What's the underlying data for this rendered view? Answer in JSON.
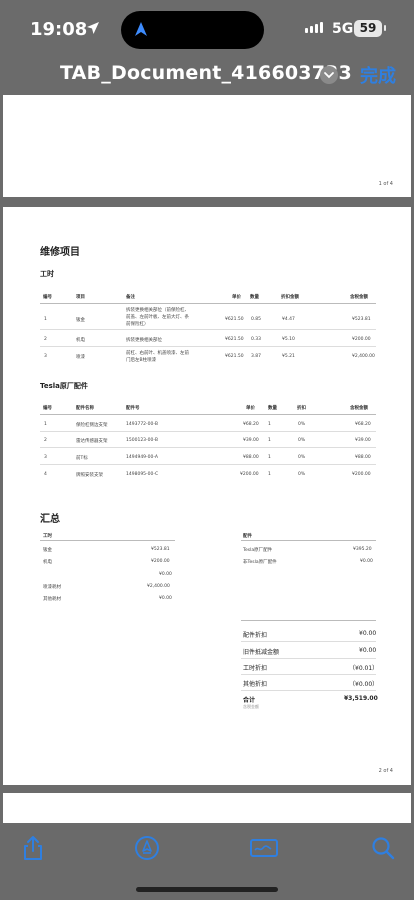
{
  "status": {
    "time": "19:08",
    "network": "5G",
    "battery": "59"
  },
  "titlebar": {
    "title": "TAB_Document_416603733",
    "done": "完成"
  },
  "page1": {
    "page_number": "1 of 4"
  },
  "page2": {
    "page_number": "2 of 4",
    "section_title": "维修项目",
    "labor": {
      "title": "工时",
      "headers": [
        "编号",
        "项目",
        "备注",
        "单价",
        "数量",
        "折扣金额",
        "含税金额"
      ],
      "rows": [
        [
          "1",
          "钣金",
          "",
          "¥621.50",
          "0.85",
          "¥4.47",
          "¥523.81"
        ],
        [
          "2",
          "机电",
          "拆装更换相关部位",
          "¥621.50",
          "0.33",
          "¥5.10",
          "¥200.00"
        ],
        [
          "3",
          "喷漆",
          "",
          "¥621.50",
          "3.87",
          "¥5.21",
          "¥2,400.00"
        ]
      ],
      "row1_note": [
        "拆装更换相关部位（前保险杠、",
        "前盖、左前叶板、左前大灯、条",
        "前保险杠）"
      ],
      "row3_note": [
        "前杠、右前叶、机盖喷漆、左前",
        "门后左B柱喷漆"
      ]
    },
    "parts": {
      "title": "Tesla原厂配件",
      "headers": [
        "编号",
        "配件名称",
        "配件号",
        "单价",
        "数量",
        "折扣",
        "含税金额"
      ],
      "rows": [
        [
          "1",
          "保险杠侧边支架",
          "1493772-00-B",
          "¥68.20",
          "1",
          "0%",
          "¥68.20"
        ],
        [
          "2",
          "雷达传感器支架",
          "1500123-00-B",
          "¥39.00",
          "1",
          "0%",
          "¥39.00"
        ],
        [
          "3",
          "前T标",
          "1494949-00-A",
          "¥88.00",
          "1",
          "0%",
          "¥88.00"
        ],
        [
          "4",
          "牌照安装支架",
          "1498095-00-C",
          "¥200.00",
          "1",
          "0%",
          "¥200.00"
        ]
      ]
    },
    "summary": {
      "title": "汇总",
      "labor_heading": "工时",
      "parts_heading": "配件",
      "labor_rows": [
        [
          "钣金",
          "¥523.81"
        ],
        [
          "机电",
          "¥200.00"
        ],
        [
          "",
          "¥0.00"
        ],
        [
          "喷漆耗材",
          "¥2,400.00"
        ],
        [
          "其他耗材",
          "¥0.00"
        ]
      ],
      "parts_rows": [
        [
          "Tesla原厂配件",
          "¥395.20"
        ],
        [
          "非Tesla原厂配件",
          "¥0.00"
        ]
      ],
      "totals": [
        [
          "配件折扣",
          "¥0.00"
        ],
        [
          "旧件抵减金额",
          "¥0.00"
        ],
        [
          "工时折扣",
          "（¥0.01）"
        ],
        [
          "其他折扣",
          "（¥0.00）"
        ],
        [
          "合计",
          "¥3,519.00"
        ]
      ],
      "total_note": "含税金额"
    }
  },
  "toolbar": {
    "share": "share-icon",
    "markup": "markup-icon",
    "signature": "signature-icon",
    "search": "search-icon"
  },
  "colors": {
    "accent": "#2f7fe0",
    "chrome": "#6b6b6b"
  }
}
